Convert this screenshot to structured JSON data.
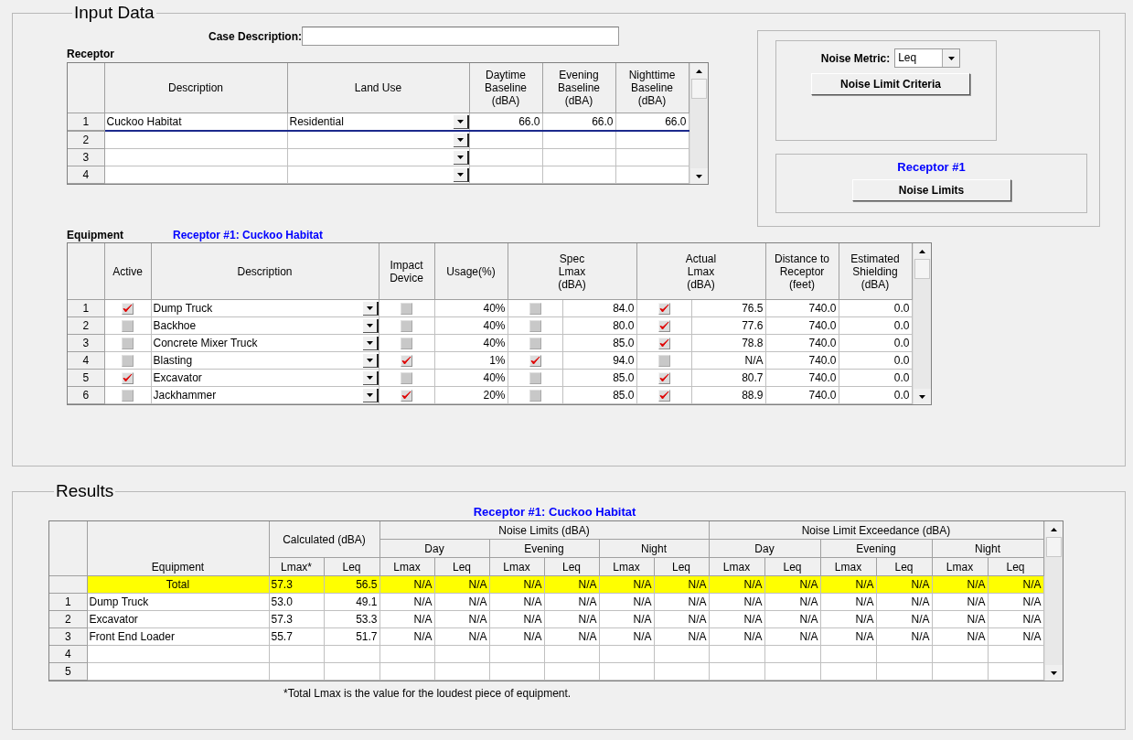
{
  "input_data": {
    "title": "Input Data",
    "case_description": {
      "label": "Case Description:"
    },
    "receptor": {
      "title": "Receptor",
      "columns": [
        "Description",
        "Land Use",
        "Daytime\nBaseline\n(dBA)",
        "Evening\nBaseline\n(dBA)",
        "Nighttime\nBaseline\n(dBA)"
      ],
      "rows": [
        {
          "number": "1",
          "description": "Cuckoo Habitat",
          "land_use": "Residential",
          "daytime": "66.0",
          "evening": "66.0",
          "nighttime": "66.0",
          "selected": true
        },
        {
          "number": "2",
          "selected": false
        },
        {
          "number": "3",
          "selected": false
        },
        {
          "number": "4",
          "selected": false
        }
      ]
    },
    "noise_metric": {
      "label": "Noise Metric:",
      "value": "Leq",
      "button": "Noise Limit Criteria"
    },
    "receptor_limits": {
      "title": "Receptor #1",
      "button": "Noise Limits"
    },
    "equipment": {
      "title": "Equipment",
      "subtitle": "Receptor #1: Cuckoo Habitat",
      "columns": [
        "Active",
        "Description",
        "Impact\nDevice",
        "Usage(%)",
        "Spec\nLmax\n(dBA)",
        "Actual\nLmax\n(dBA)",
        "Distance to\nReceptor\n(feet)",
        "Estimated\nShielding\n(dBA)"
      ],
      "rows": [
        {
          "number": "1",
          "active": true,
          "description": "Dump Truck",
          "impact_device": false,
          "usage": "40%",
          "spec_checked": false,
          "spec_lmax": "84.0",
          "actual_checked": true,
          "actual_lmax": "76.5",
          "distance": "740.0",
          "shielding": "0.0"
        },
        {
          "number": "2",
          "active": false,
          "description": "Backhoe",
          "impact_device": false,
          "usage": "40%",
          "spec_checked": false,
          "spec_lmax": "80.0",
          "actual_checked": true,
          "actual_lmax": "77.6",
          "distance": "740.0",
          "shielding": "0.0"
        },
        {
          "number": "3",
          "active": false,
          "description": "Concrete Mixer Truck",
          "impact_device": false,
          "usage": "40%",
          "spec_checked": false,
          "spec_lmax": "85.0",
          "actual_checked": true,
          "actual_lmax": "78.8",
          "distance": "740.0",
          "shielding": "0.0"
        },
        {
          "number": "4",
          "active": false,
          "description": "Blasting",
          "impact_device": true,
          "usage": "1%",
          "spec_checked": true,
          "spec_lmax": "94.0",
          "actual_checked": false,
          "actual_lmax": "N/A",
          "distance": "740.0",
          "shielding": "0.0"
        },
        {
          "number": "5",
          "active": true,
          "description": "Excavator",
          "impact_device": false,
          "usage": "40%",
          "spec_checked": false,
          "spec_lmax": "85.0",
          "actual_checked": true,
          "actual_lmax": "80.7",
          "distance": "740.0",
          "shielding": "0.0"
        },
        {
          "number": "6",
          "active": false,
          "description": "Jackhammer",
          "impact_device": true,
          "usage": "20%",
          "spec_checked": false,
          "spec_lmax": "85.0",
          "actual_checked": true,
          "actual_lmax": "88.9",
          "distance": "740.0",
          "shielding": "0.0"
        }
      ]
    }
  },
  "results": {
    "title": "Results",
    "subtitle": "Receptor #1: Cuckoo Habitat",
    "equipment_header": "Equipment",
    "calculated": {
      "title": "Calculated (dBA)",
      "columns": [
        "Lmax*",
        "Leq"
      ]
    },
    "groups": [
      {
        "title": "Noise Limits (dBA)",
        "periods": [
          {
            "title": "Day",
            "columns": [
              "Lmax",
              "Leq"
            ]
          },
          {
            "title": "Evening",
            "columns": [
              "Lmax",
              "Leq"
            ]
          },
          {
            "title": "Night",
            "columns": [
              "Lmax",
              "Leq"
            ]
          }
        ]
      },
      {
        "title": "Noise Limit Exceedance (dBA)",
        "periods": [
          {
            "title": "Day",
            "columns": [
              "Lmax",
              "Leq"
            ]
          },
          {
            "title": "Evening",
            "columns": [
              "Lmax",
              "Leq"
            ]
          },
          {
            "title": "Night",
            "columns": [
              "Lmax",
              "Leq"
            ]
          }
        ]
      }
    ],
    "rows": [
      {
        "kind": "total",
        "label": "Total",
        "values": [
          "57.3",
          "56.5",
          "N/A",
          "N/A",
          "N/A",
          "N/A",
          "N/A",
          "N/A",
          "N/A",
          "N/A",
          "N/A",
          "N/A",
          "N/A",
          "N/A"
        ]
      },
      {
        "kind": "item",
        "number": "1",
        "label": "Dump Truck",
        "values": [
          "53.0",
          "49.1",
          "N/A",
          "N/A",
          "N/A",
          "N/A",
          "N/A",
          "N/A",
          "N/A",
          "N/A",
          "N/A",
          "N/A",
          "N/A",
          "N/A"
        ]
      },
      {
        "kind": "item",
        "number": "2",
        "label": "Excavator",
        "values": [
          "57.3",
          "53.3",
          "N/A",
          "N/A",
          "N/A",
          "N/A",
          "N/A",
          "N/A",
          "N/A",
          "N/A",
          "N/A",
          "N/A",
          "N/A",
          "N/A"
        ]
      },
      {
        "kind": "item",
        "number": "3",
        "label": "Front End Loader",
        "values": [
          "55.7",
          "51.7",
          "N/A",
          "N/A",
          "N/A",
          "N/A",
          "N/A",
          "N/A",
          "N/A",
          "N/A",
          "N/A",
          "N/A",
          "N/A",
          "N/A"
        ]
      },
      {
        "kind": "item",
        "number": "4"
      },
      {
        "kind": "item",
        "number": "5"
      }
    ],
    "footnote": "*Total Lmax is the value for the loudest piece of equipment."
  }
}
